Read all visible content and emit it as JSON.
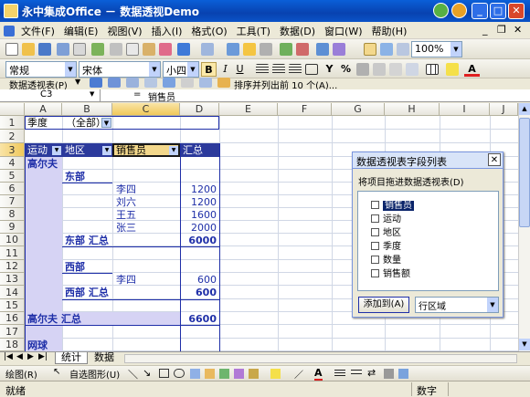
{
  "window": {
    "title": "永中集成Office － 数据透视Demo",
    "minimize": "_",
    "maximize": "□",
    "close": "✕",
    "doc_minimize": "_",
    "doc_restore": "❐",
    "doc_close": "✕"
  },
  "menu": [
    "文件(F)",
    "编辑(E)",
    "视图(V)",
    "插入(I)",
    "格式(O)",
    "工具(T)",
    "数据(D)",
    "窗口(W)",
    "帮助(H)"
  ],
  "toolbar": {
    "zoom": "100%"
  },
  "format_toolbar": {
    "style": "常规",
    "font": "宋体",
    "size": "小四",
    "bold": "B",
    "italic": "I",
    "underline": "U",
    "currency": "Y",
    "percent": "%"
  },
  "pivot_toolbar": {
    "label": "数据透视表(P)",
    "sort_label": "排序并列出前 10 个(A)..."
  },
  "formula_bar": {
    "cell_ref": "C3",
    "equals": "=",
    "content": "销售员"
  },
  "columns": [
    "A",
    "B",
    "C",
    "D",
    "E",
    "F",
    "G",
    "H",
    "I",
    "J"
  ],
  "rows": [
    "1",
    "2",
    "3",
    "4",
    "5",
    "6",
    "7",
    "8",
    "9",
    "10",
    "11",
    "12",
    "13",
    "14",
    "15",
    "16",
    "17",
    "18"
  ],
  "cells": {
    "a1": "季度",
    "b1": "（全部）",
    "a3": "运动",
    "b3": "地区",
    "c3": "销售员",
    "d3": "汇总",
    "a4": "高尔夫",
    "b5": "东部",
    "c6": "李四",
    "d6": "1200",
    "c7": "刘六",
    "d7": "1200",
    "c8": "王五",
    "d8": "1600",
    "c9": "张三",
    "d9": "2000",
    "b10": "东部  汇总",
    "d10": "6000",
    "b12": "西部",
    "c13": "李四",
    "d13": "600",
    "b14": "西部  汇总",
    "d14": "600",
    "a16": "高尔夫  汇总",
    "d16": "6600",
    "a18": "网球"
  },
  "sheet_tabs": [
    "统计",
    "数据"
  ],
  "draw_toolbar": {
    "draw": "绘图(R)",
    "autoshape": "自选图形(U)"
  },
  "status": {
    "left": "就绪",
    "mode": "数字"
  },
  "pivot_panel": {
    "title": "数据透视表字段列表",
    "instructions": "将项目拖进数据透视表(D)",
    "fields": [
      "销售员",
      "运动",
      "地区",
      "季度",
      "数量",
      "销售额"
    ],
    "add_button": "添加到(A)",
    "target": "行区域"
  },
  "colors": {
    "title_bar": "#0842b0",
    "pivot_row_header": "#d6d3f4",
    "pivot_border": "#1f2fa8",
    "selection_fill": "#f3d88c"
  }
}
